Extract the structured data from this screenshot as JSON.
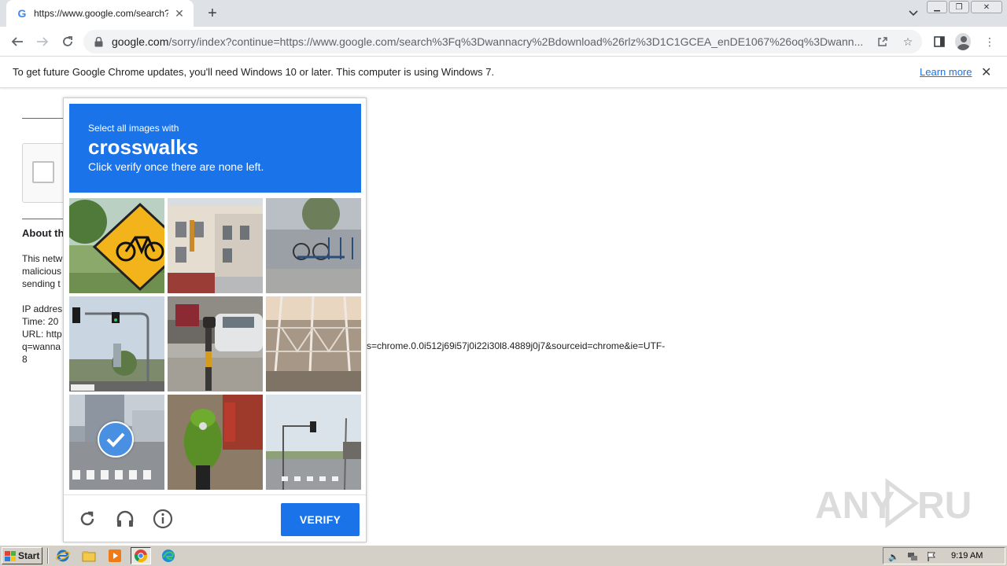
{
  "browser": {
    "tab_title": "https://www.google.com/search?q=",
    "tab_favicon": "G",
    "url_host": "google.com",
    "url_path": "/sorry/index?continue=https://www.google.com/search%3Fq%3Dwannacry%2Bdownload%26rlz%3D1C1GCEA_enDE1067%26oq%3Dwann..."
  },
  "infobar": {
    "message": "To get future Google Chrome updates, you'll need Windows 10 or later. This computer is using Windows 7.",
    "learn_more": "Learn more"
  },
  "page": {
    "about_heading": "About th",
    "para_lines": [
      "This netw",
      "malicious",
      "sending t"
    ],
    "info_lines": [
      "IP addres",
      "Time: 20",
      "URL: http",
      "q=wanna",
      "8"
    ],
    "url_tail": "s=chrome.0.0i512j69i57j0i22i30l8.4889j0j7&sourceid=chrome&ie=UTF-"
  },
  "captcha": {
    "instruction": "Select all images with",
    "target": "crosswalks",
    "hint": "Click verify once there are none left.",
    "verify_label": "VERIFY",
    "tiles": [
      {
        "name": "bicycle-sign",
        "selected": false
      },
      {
        "name": "building-street",
        "selected": false
      },
      {
        "name": "bike-rack-street",
        "selected": false
      },
      {
        "name": "traffic-lights",
        "selected": false
      },
      {
        "name": "parked-cars",
        "selected": false
      },
      {
        "name": "power-lines",
        "selected": false
      },
      {
        "name": "crosswalk-road",
        "selected": true
      },
      {
        "name": "green-scooter",
        "selected": false
      },
      {
        "name": "crosswalk-intersection",
        "selected": false
      }
    ]
  },
  "watermark": "ANY RUN",
  "taskbar": {
    "start_label": "Start",
    "clock": "9:19 AM"
  },
  "colors": {
    "accent": "#1a73e8",
    "taskbar": "#d4d0c8"
  }
}
